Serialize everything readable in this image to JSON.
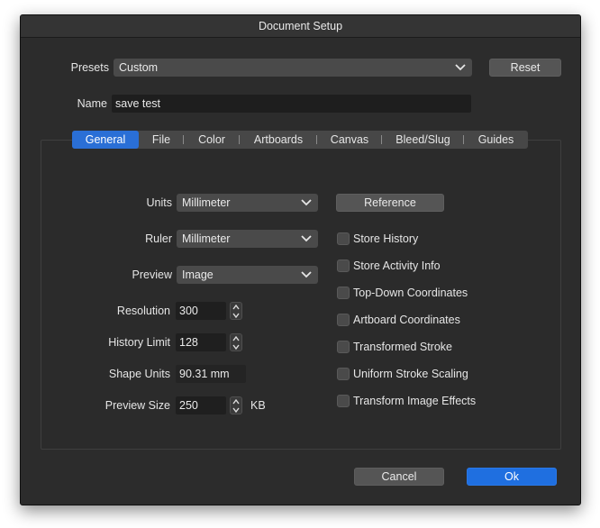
{
  "window": {
    "title": "Document Setup"
  },
  "presets": {
    "label": "Presets",
    "value": "Custom",
    "reset_label": "Reset"
  },
  "name": {
    "label": "Name",
    "value": "save test"
  },
  "tabs": [
    "General",
    "File",
    "Color",
    "Artboards",
    "Canvas",
    "Bleed/Slug",
    "Guides"
  ],
  "active_tab": "General",
  "general": {
    "units": {
      "label": "Units",
      "value": "Millimeter"
    },
    "ruler": {
      "label": "Ruler",
      "value": "Millimeter"
    },
    "preview": {
      "label": "Preview",
      "value": "Image"
    },
    "resolution": {
      "label": "Resolution",
      "value": "300"
    },
    "history_limit": {
      "label": "History Limit",
      "value": "128"
    },
    "shape_units": {
      "label": "Shape Units",
      "value": "90.31 mm"
    },
    "preview_size": {
      "label": "Preview Size",
      "value": "250",
      "unit": "KB"
    },
    "reference_label": "Reference",
    "checkboxes": [
      {
        "label": "Store History",
        "checked": false
      },
      {
        "label": "Store Activity Info",
        "checked": false
      },
      {
        "label": "Top-Down Coordinates",
        "checked": false
      },
      {
        "label": "Artboard Coordinates",
        "checked": false
      },
      {
        "label": "Transformed Stroke",
        "checked": false
      },
      {
        "label": "Uniform Stroke Scaling",
        "checked": false
      },
      {
        "label": "Transform Image Effects",
        "checked": false
      }
    ]
  },
  "footer": {
    "cancel_label": "Cancel",
    "ok_label": "Ok"
  },
  "colors": {
    "accent": "#1f6fe0",
    "background": "#2c2c2c",
    "control": "#4a4a4a"
  }
}
